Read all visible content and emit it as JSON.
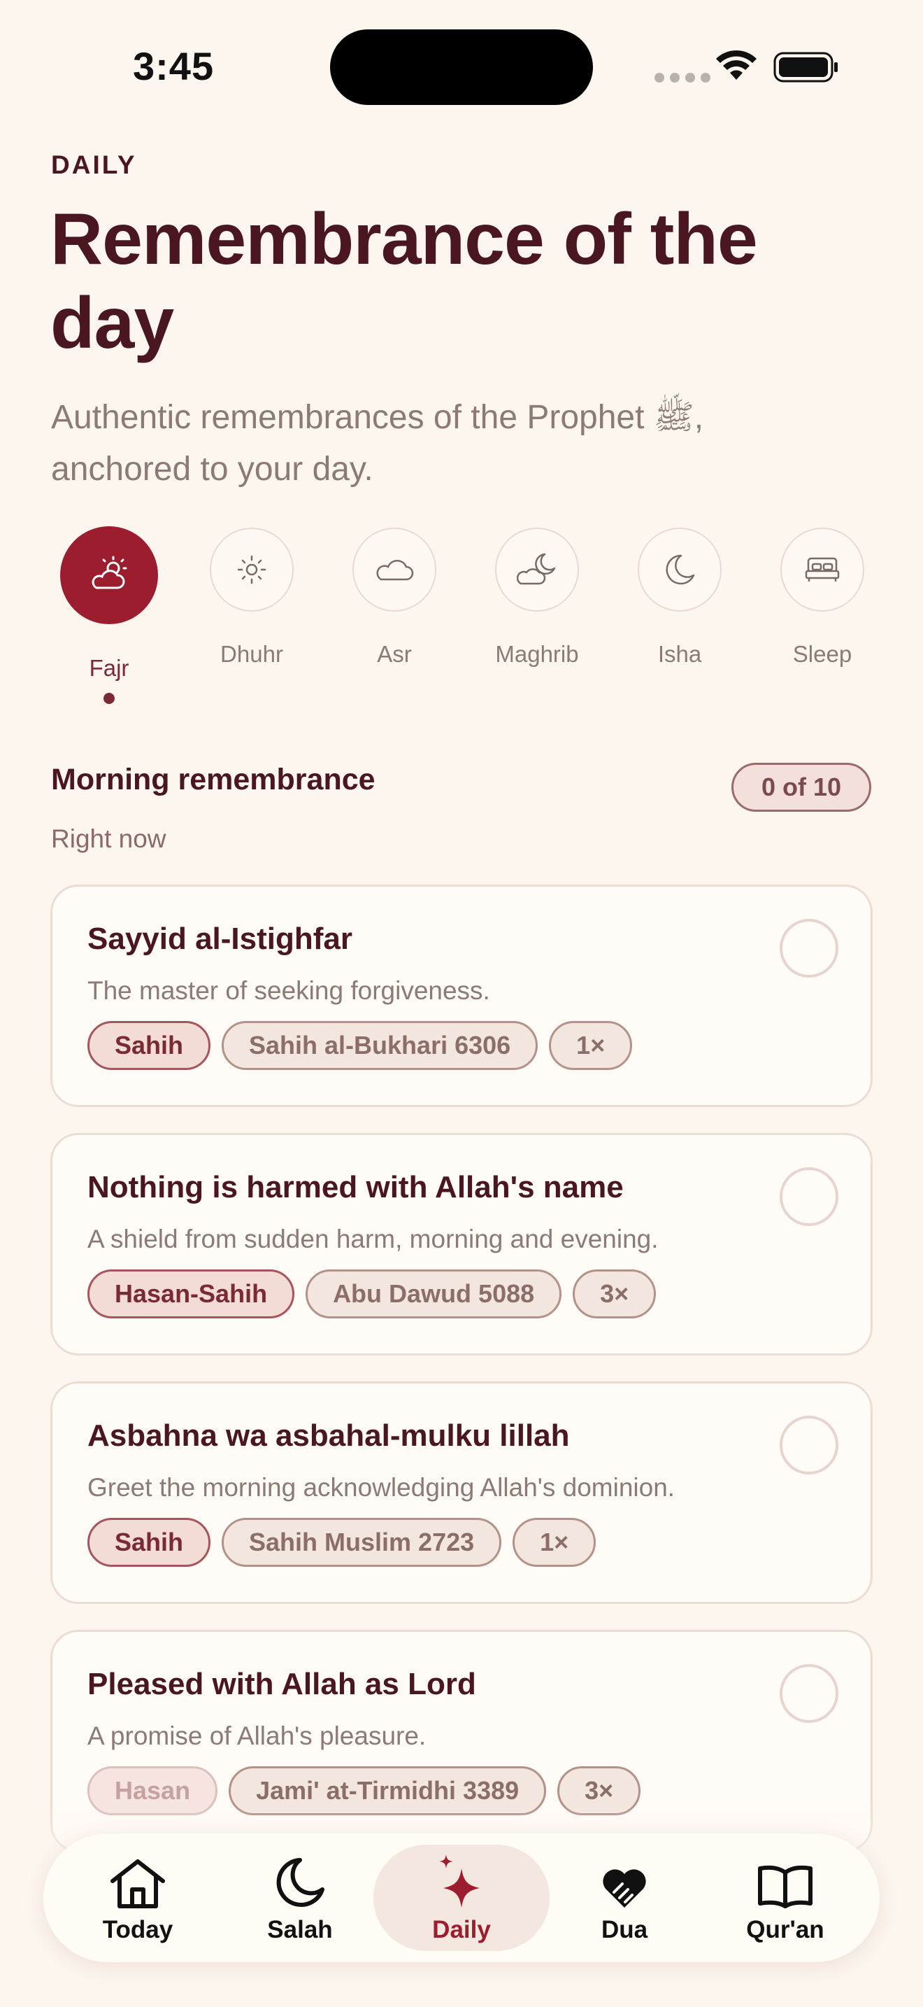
{
  "status": {
    "time": "3:45"
  },
  "header": {
    "eyebrow": "DAILY",
    "title": "Remembrance of the day",
    "subtitle": "Authentic remembrances of the Prophet ﷺ, anchored to your day."
  },
  "prayer_times": [
    {
      "label": "Fajr",
      "icon": "sun-cloud-icon",
      "active": true
    },
    {
      "label": "Dhuhr",
      "icon": "sun-icon",
      "active": false
    },
    {
      "label": "Asr",
      "icon": "cloud-icon",
      "active": false
    },
    {
      "label": "Maghrib",
      "icon": "moon-cloud-icon",
      "active": false
    },
    {
      "label": "Isha",
      "icon": "moon-icon",
      "active": false
    },
    {
      "label": "Sleep",
      "icon": "bed-icon",
      "active": false
    }
  ],
  "section": {
    "title": "Morning remembrance",
    "subtitle": "Right now",
    "progress": "0 of 10"
  },
  "cards": [
    {
      "title": "Sayyid al-Istighfar",
      "desc": "The master of seeking forgiveness.",
      "grade": "Sahih",
      "source": "Sahih al-Bukhari 6306",
      "count": "1×"
    },
    {
      "title": "Nothing is harmed with Allah's name",
      "desc": "A shield from sudden harm, morning and evening.",
      "grade": "Hasan-Sahih",
      "source": "Abu Dawud 5088",
      "count": "3×"
    },
    {
      "title": "Asbahna wa asbahal-mulku lillah",
      "desc": "Greet the morning acknowledging Allah's dominion.",
      "grade": "Sahih",
      "source": "Sahih Muslim 2723",
      "count": "1×"
    },
    {
      "title": "Pleased with Allah as Lord",
      "desc": "A promise of Allah's pleasure.",
      "grade": "Hasan",
      "source": "Jami' at-Tirmidhi 3389",
      "count": "3×"
    }
  ],
  "tabs": [
    {
      "label": "Today",
      "icon": "house-icon"
    },
    {
      "label": "Salah",
      "icon": "crescent-moon-icon"
    },
    {
      "label": "Daily",
      "icon": "sparkles-icon",
      "active": true
    },
    {
      "label": "Dua",
      "icon": "heart-hands-icon"
    },
    {
      "label": "Qur'an",
      "icon": "open-book-icon"
    }
  ],
  "colors": {
    "accent": "#9b1d2e",
    "text": "#4a1620",
    "background": "#fdf6ee"
  }
}
